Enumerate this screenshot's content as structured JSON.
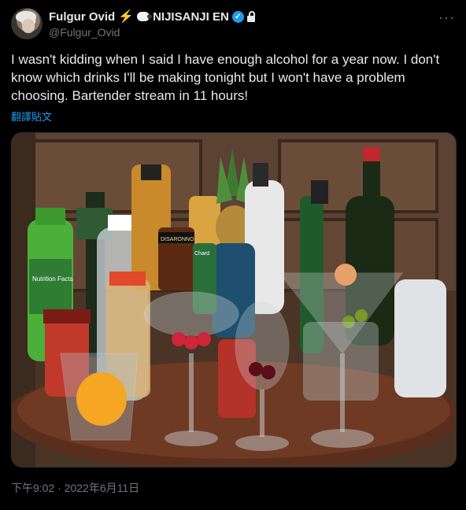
{
  "author": {
    "display_name": "Fulgur Ovid",
    "suffix": "NIJISANJI EN",
    "handle": "@Fulgur_Ovid"
  },
  "icons": {
    "bolt": "lightning-bolt-icon",
    "sheep": "sheep-icon",
    "verified": "verified-badge-icon",
    "lock": "lock-icon",
    "more": "more-options-icon"
  },
  "tweet": {
    "text": "I wasn't kidding when I said I have enough alcohol for a year now. I don't know which drinks I'll be making tonight but I won't have a problem choosing. Bartender stream in 11 hours!",
    "translate_label": "翻譯貼文",
    "timestamp": "下午9:02 · 2022年6月11日"
  },
  "photo": {
    "bottle_labels": [
      "DISARONNO",
      "Chard",
      "Nutrition Facts"
    ]
  },
  "colors": {
    "background": "#000000",
    "text": "#e7e9ea",
    "muted": "#71767b",
    "link": "#1d9bf0"
  }
}
